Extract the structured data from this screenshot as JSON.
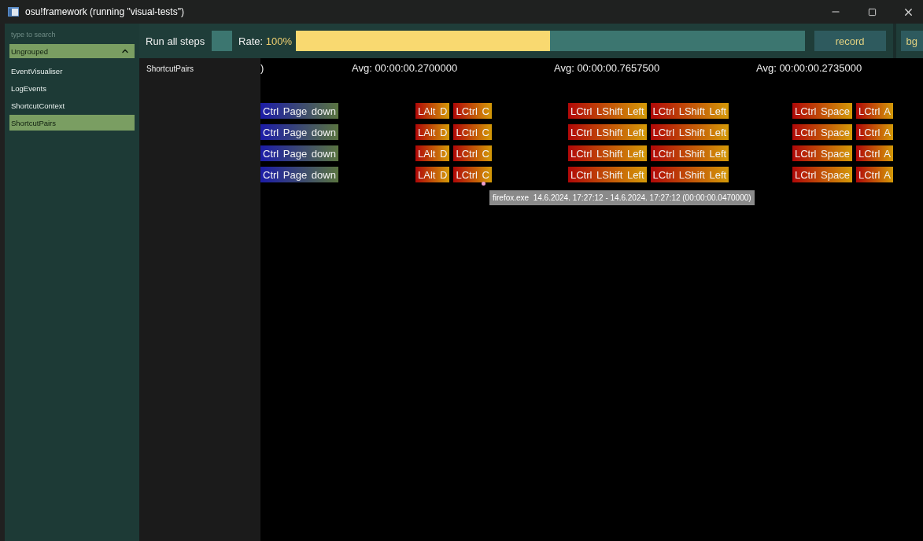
{
  "window": {
    "title": "osu!framework (running \"visual-tests\")"
  },
  "sidebar": {
    "search": {
      "placeholder": "type to search"
    },
    "groups": [
      {
        "label": "Ungrouped",
        "expanded": true,
        "items": [
          {
            "label": "EventVisualiser",
            "selected": false
          },
          {
            "label": "LogEvents",
            "selected": false
          },
          {
            "label": "ShortcutContext",
            "selected": false
          },
          {
            "label": "ShortcutPairs",
            "selected": true
          }
        ]
      }
    ]
  },
  "scene_list": {
    "items": [
      "ShortcutPairs"
    ]
  },
  "toolbar": {
    "run_all_steps": {
      "label": "Run all steps",
      "checked": false
    },
    "rate": {
      "label": "Rate:",
      "value": "100%",
      "level": 0.5
    },
    "buttons": [
      "record",
      "bg"
    ]
  },
  "timeline": {
    "averages": [
      ")",
      "Avg: 00:00:00.2700000",
      "Avg: 00:00:00.7657500",
      "Avg: 00:00:00.2735000"
    ],
    "columns": [
      {
        "rows": [
          [
            {
              "label": "Ctrl Page down",
              "kind": "navigation"
            }
          ],
          [
            {
              "label": "Ctrl Page down",
              "kind": "navigation"
            }
          ],
          [
            {
              "label": "Ctrl Page down",
              "kind": "navigation"
            }
          ],
          [
            {
              "label": "Ctrl Page down",
              "kind": "navigation"
            }
          ]
        ]
      },
      {
        "rows": [
          [
            {
              "label": "LAlt D",
              "kind": "shortcut"
            },
            {
              "label": "LCtrl C",
              "kind": "shortcut"
            }
          ],
          [
            {
              "label": "LAlt D",
              "kind": "shortcut"
            },
            {
              "label": "LCtrl C",
              "kind": "shortcut"
            }
          ],
          [
            {
              "label": "LAlt D",
              "kind": "shortcut"
            },
            {
              "label": "LCtrl C",
              "kind": "shortcut"
            }
          ],
          [
            {
              "label": "LAlt D",
              "kind": "shortcut"
            },
            {
              "label": "LCtrl C",
              "kind": "shortcut"
            }
          ]
        ]
      },
      {
        "rows": [
          [
            {
              "label": "LCtrl LShift Left",
              "kind": "shortcut"
            },
            {
              "label": "LCtrl LShift Left",
              "kind": "shortcut"
            }
          ],
          [
            {
              "label": "LCtrl LShift Left",
              "kind": "shortcut"
            },
            {
              "label": "LCtrl LShift Left",
              "kind": "shortcut"
            }
          ],
          [
            {
              "label": "LCtrl LShift Left",
              "kind": "shortcut"
            },
            {
              "label": "LCtrl LShift Left",
              "kind": "shortcut"
            }
          ],
          [
            {
              "label": "LCtrl LShift Left",
              "kind": "shortcut"
            },
            {
              "label": "LCtrl LShift Left",
              "kind": "shortcut"
            }
          ]
        ]
      },
      {
        "rows": [
          [
            {
              "label": "LCtrl Space",
              "kind": "shortcut"
            },
            {
              "label": "LCtrl A",
              "kind": "shortcut"
            }
          ],
          [
            {
              "label": "LCtrl Space",
              "kind": "shortcut"
            },
            {
              "label": "LCtrl A",
              "kind": "shortcut"
            }
          ],
          [
            {
              "label": "LCtrl Space",
              "kind": "shortcut"
            },
            {
              "label": "LCtrl A",
              "kind": "shortcut"
            }
          ],
          [
            {
              "label": "LCtrl Space",
              "kind": "shortcut"
            },
            {
              "label": "LCtrl A",
              "kind": "shortcut"
            }
          ]
        ]
      }
    ],
    "tooltip": "firefox.exe  14.6.2024. 17:27:12 - 14.6.2024. 17:27:12 (00:00:00.0470000)"
  }
}
